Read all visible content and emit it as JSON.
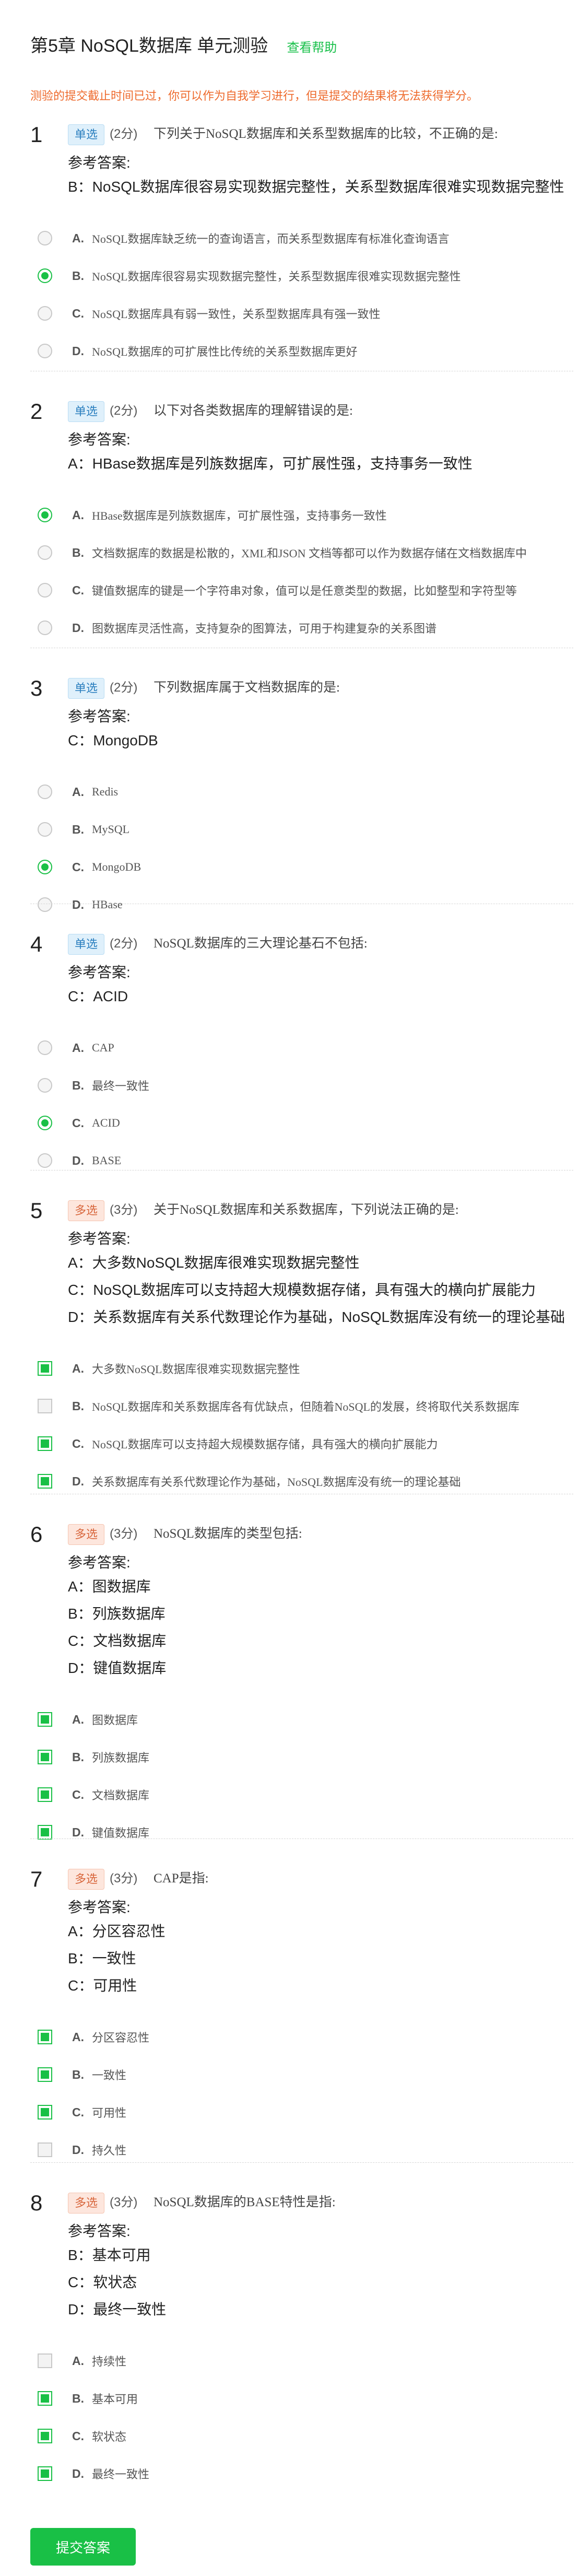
{
  "header": {
    "title": "第5章 NoSQL数据库 单元测验",
    "help_link": "查看帮助"
  },
  "notice": "测验的提交截止时间已过，你可以作为自我学习进行，但是提交的结果将无法获得学分。",
  "answer_label": "参考答案:",
  "submit_label": "提交答案",
  "questions": [
    {
      "num": "1",
      "type": "单选",
      "kind": "single",
      "score": "(2分)",
      "stem": "下列关于NoSQL数据库和关系型数据库的比较，不正确的是:",
      "answers": [
        "B：NoSQL数据库很容易实现数据完整性，关系型数据库很难实现数据完整性"
      ],
      "options": [
        {
          "letter": "A.",
          "text": "NoSQL数据库缺乏统一的查询语言，而关系型数据库有标准化查询语言",
          "selected": false
        },
        {
          "letter": "B.",
          "text": "NoSQL数据库很容易实现数据完整性，关系型数据库很难实现数据完整性",
          "selected": true
        },
        {
          "letter": "C.",
          "text": "NoSQL数据库具有弱一致性，关系型数据库具有强一致性",
          "selected": false
        },
        {
          "letter": "D.",
          "text": "NoSQL数据库的可扩展性比传统的关系型数据库更好",
          "selected": false
        }
      ]
    },
    {
      "num": "2",
      "type": "单选",
      "kind": "single",
      "score": "(2分)",
      "stem": "以下对各类数据库的理解错误的是:",
      "answers": [
        "A：HBase数据库是列族数据库，可扩展性强，支持事务一致性"
      ],
      "options": [
        {
          "letter": "A.",
          "text": "HBase数据库是列族数据库，可扩展性强，支持事务一致性",
          "selected": true
        },
        {
          "letter": "B.",
          "text": "文档数据库的数据是松散的，XML和JSON 文档等都可以作为数据存储在文档数据库中",
          "selected": false
        },
        {
          "letter": "C.",
          "text": "键值数据库的键是一个字符串对象，值可以是任意类型的数据，比如整型和字符型等",
          "selected": false
        },
        {
          "letter": "D.",
          "text": "图数据库灵活性高，支持复杂的图算法，可用于构建复杂的关系图谱",
          "selected": false
        }
      ]
    },
    {
      "num": "3",
      "type": "单选",
      "kind": "single",
      "score": "(2分)",
      "stem": "下列数据库属于文档数据库的是:",
      "answers": [
        "C：MongoDB"
      ],
      "options": [
        {
          "letter": "A.",
          "text": "Redis",
          "selected": false
        },
        {
          "letter": "B.",
          "text": "MySQL",
          "selected": false
        },
        {
          "letter": "C.",
          "text": "MongoDB",
          "selected": true
        },
        {
          "letter": "D.",
          "text": "HBase",
          "selected": false
        }
      ]
    },
    {
      "num": "4",
      "type": "单选",
      "kind": "single",
      "score": "(2分)",
      "stem": "NoSQL数据库的三大理论基石不包括:",
      "answers": [
        "C：ACID"
      ],
      "options": [
        {
          "letter": "A.",
          "text": "CAP",
          "selected": false
        },
        {
          "letter": "B.",
          "text": "最终一致性",
          "selected": false
        },
        {
          "letter": "C.",
          "text": "ACID",
          "selected": true
        },
        {
          "letter": "D.",
          "text": "BASE",
          "selected": false
        }
      ]
    },
    {
      "num": "5",
      "type": "多选",
      "kind": "multi",
      "score": "(3分)",
      "stem": "关于NoSQL数据库和关系数据库，下列说法正确的是:",
      "answers": [
        "A：大多数NoSQL数据库很难实现数据完整性",
        "C：NoSQL数据库可以支持超大规模数据存储，具有强大的横向扩展能力",
        "D：关系数据库有关系代数理论作为基础，NoSQL数据库没有统一的理论基础"
      ],
      "options": [
        {
          "letter": "A.",
          "text": "大多数NoSQL数据库很难实现数据完整性",
          "selected": true
        },
        {
          "letter": "B.",
          "text": "NoSQL数据库和关系数据库各有优缺点，但随着NoSQL的发展，终将取代关系数据库",
          "selected": false
        },
        {
          "letter": "C.",
          "text": "NoSQL数据库可以支持超大规模数据存储，具有强大的横向扩展能力",
          "selected": true
        },
        {
          "letter": "D.",
          "text": "关系数据库有关系代数理论作为基础，NoSQL数据库没有统一的理论基础",
          "selected": true
        }
      ]
    },
    {
      "num": "6",
      "type": "多选",
      "kind": "multi",
      "score": "(3分)",
      "stem": "NoSQL数据库的类型包括:",
      "answers": [
        "A：图数据库",
        "B：列族数据库",
        "C：文档数据库",
        "D：键值数据库"
      ],
      "options": [
        {
          "letter": "A.",
          "text": "图数据库",
          "selected": true
        },
        {
          "letter": "B.",
          "text": "列族数据库",
          "selected": true
        },
        {
          "letter": "C.",
          "text": "文档数据库",
          "selected": true
        },
        {
          "letter": "D.",
          "text": "键值数据库",
          "selected": true
        }
      ]
    },
    {
      "num": "7",
      "type": "多选",
      "kind": "multi",
      "score": "(3分)",
      "stem": "CAP是指:",
      "answers": [
        "A：分区容忍性",
        "B：一致性",
        "C：可用性"
      ],
      "options": [
        {
          "letter": "A.",
          "text": "分区容忍性",
          "selected": true
        },
        {
          "letter": "B.",
          "text": "一致性",
          "selected": true
        },
        {
          "letter": "C.",
          "text": "可用性",
          "selected": true
        },
        {
          "letter": "D.",
          "text": "持久性",
          "selected": false
        }
      ]
    },
    {
      "num": "8",
      "type": "多选",
      "kind": "multi",
      "score": "(3分)",
      "stem": "NoSQL数据库的BASE特性是指:",
      "answers": [
        "B：基本可用",
        "C：软状态",
        "D：最终一致性"
      ],
      "options": [
        {
          "letter": "A.",
          "text": "持续性",
          "selected": false
        },
        {
          "letter": "B.",
          "text": "基本可用",
          "selected": true
        },
        {
          "letter": "C.",
          "text": "软状态",
          "selected": true
        },
        {
          "letter": "D.",
          "text": "最终一致性",
          "selected": true
        }
      ]
    }
  ]
}
